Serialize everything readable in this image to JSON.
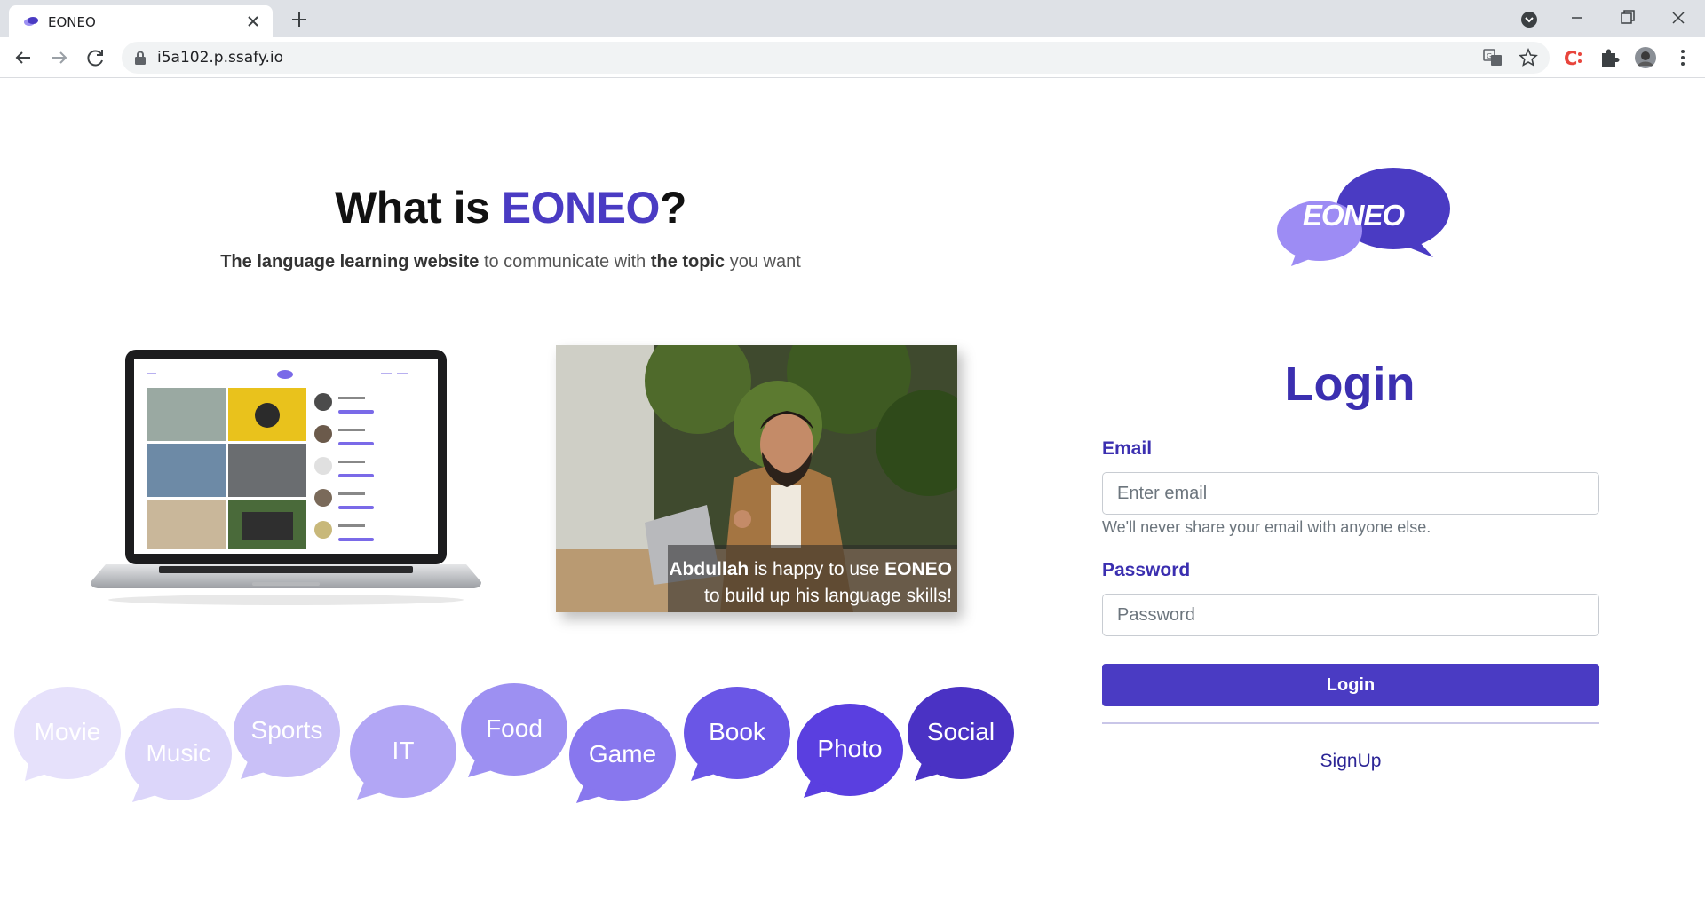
{
  "browser": {
    "tab_title": "EONEO",
    "url": "i5a102.p.ssafy.io"
  },
  "hero": {
    "title_prefix": "What is ",
    "title_brand": "EONEO",
    "title_suffix": "?",
    "subtitle_parts": [
      "The language learning website",
      " to communicate with ",
      "the topic",
      " you want"
    ]
  },
  "photo": {
    "caption_line1_name": "Abdullah",
    "caption_line1_rest": " is happy to use ",
    "caption_line1_brand": "EONEO",
    "caption_line2": "to build up his language skills!"
  },
  "topics": [
    {
      "label": "Movie",
      "color": "#e6e1fb"
    },
    {
      "label": "Music",
      "color": "#dcd6fa"
    },
    {
      "label": "Sports",
      "color": "#c9c0f7"
    },
    {
      "label": "IT",
      "color": "#b2a6f5"
    },
    {
      "label": "Food",
      "color": "#9d90f2"
    },
    {
      "label": "Game",
      "color": "#8877ee"
    },
    {
      "label": "Book",
      "color": "#6a56e6"
    },
    {
      "label": "Photo",
      "color": "#5a3fe0"
    },
    {
      "label": "Social",
      "color": "#4a32c4"
    }
  ],
  "logo": {
    "text": "EONEO"
  },
  "login": {
    "title": "Login",
    "email_label": "Email",
    "email_placeholder": "Enter email",
    "email_hint": "We'll never share your email with anyone else.",
    "password_label": "Password",
    "password_placeholder": "Password",
    "submit_label": "Login",
    "signup_label": "SignUp"
  },
  "colors": {
    "brand": "#4a3bc3",
    "brand_dark": "#3b2fb0"
  }
}
